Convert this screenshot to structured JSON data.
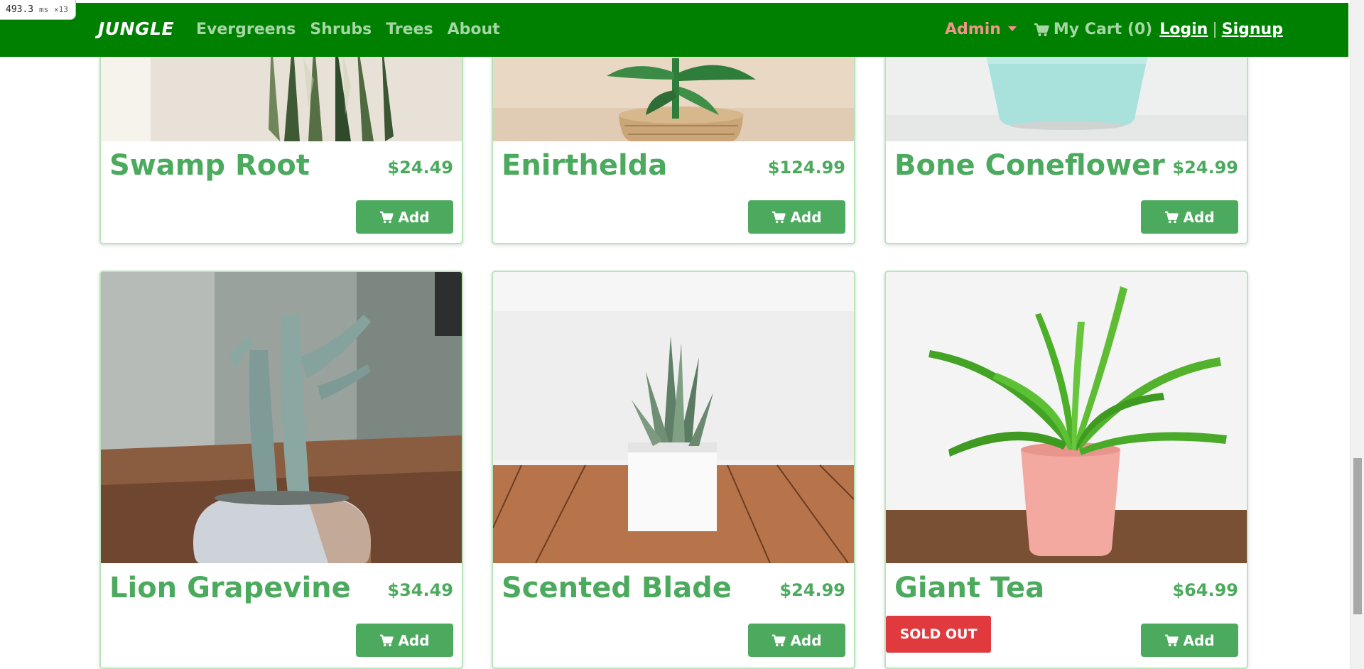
{
  "perf": {
    "value": "493.3",
    "unit": "ms",
    "mult": "×13"
  },
  "nav": {
    "brand": "JUNGLE",
    "links": [
      "Evergreens",
      "Shrubs",
      "Trees",
      "About"
    ],
    "admin": "Admin",
    "cart": "My Cart (0)",
    "login": "Login",
    "separator": "|",
    "signup": "Signup"
  },
  "products": [
    {
      "name": "Swamp Root",
      "price": "$24.49",
      "add": "Add"
    },
    {
      "name": "Enirthelda",
      "price": "$124.99",
      "add": "Add"
    },
    {
      "name": "Bone Coneflower",
      "price": "$24.99",
      "add": "Add"
    },
    {
      "name": "Lion Grapevine",
      "price": "$34.49",
      "add": "Add"
    },
    {
      "name": "Scented Blade",
      "price": "$24.99",
      "add": "Add"
    },
    {
      "name": "Giant Tea",
      "price": "$64.99",
      "add": "Add",
      "badge": "SOLD OUT"
    }
  ],
  "colors": {
    "nav_bg": "#008000",
    "accent": "#4caa5e",
    "sold_out": "#e03a3e",
    "admin": "#f1948a"
  }
}
